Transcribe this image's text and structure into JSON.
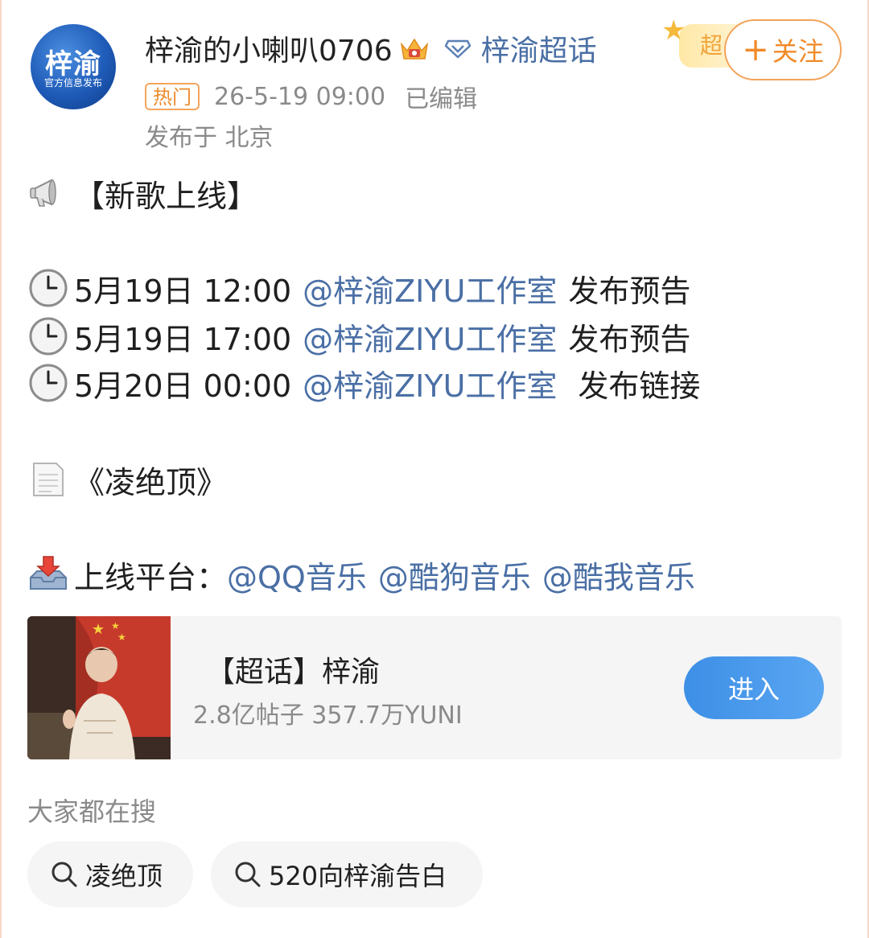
{
  "post": {
    "avatar_text": "梓渝",
    "avatar_subtext": "官方信息发布",
    "username": "梓渝的小喇叭0706",
    "supertopic_link": "梓渝超话",
    "badge_label": "超",
    "follow_label": "关注",
    "hot_tag": "热门",
    "timestamp": "26-5-19 09:00",
    "edited": "已编辑",
    "location": "发布于 北京"
  },
  "content": {
    "headline": "【新歌上线】",
    "schedule": [
      {
        "date": "5月19日 12:00",
        "mention": "@梓渝ZIYU工作室",
        "action": "发布预告"
      },
      {
        "date": "5月19日 17:00",
        "mention": "@梓渝ZIYU工作室",
        "action": "发布预告"
      },
      {
        "date": "5月20日 00:00",
        "mention": "@梓渝ZIYU工作室",
        "action": "发布链接"
      }
    ],
    "song_title": "《凌绝顶》",
    "platform_label": "上线平台：",
    "platforms": [
      "@QQ音乐",
      "@酷狗音乐",
      "@酷我音乐"
    ]
  },
  "card": {
    "title": "【超话】梓渝",
    "stats": "2.8亿帖子 357.7万YUNI",
    "enter_label": "进入"
  },
  "search": {
    "heading": "大家都在搜",
    "chips": [
      "凌绝顶",
      "520向梓渝告白"
    ]
  },
  "colors": {
    "accent_orange": "#f08a28",
    "link_blue": "#4a6fa5",
    "button_blue": "#3d8fe6",
    "muted_gray": "#8a8a8a"
  }
}
